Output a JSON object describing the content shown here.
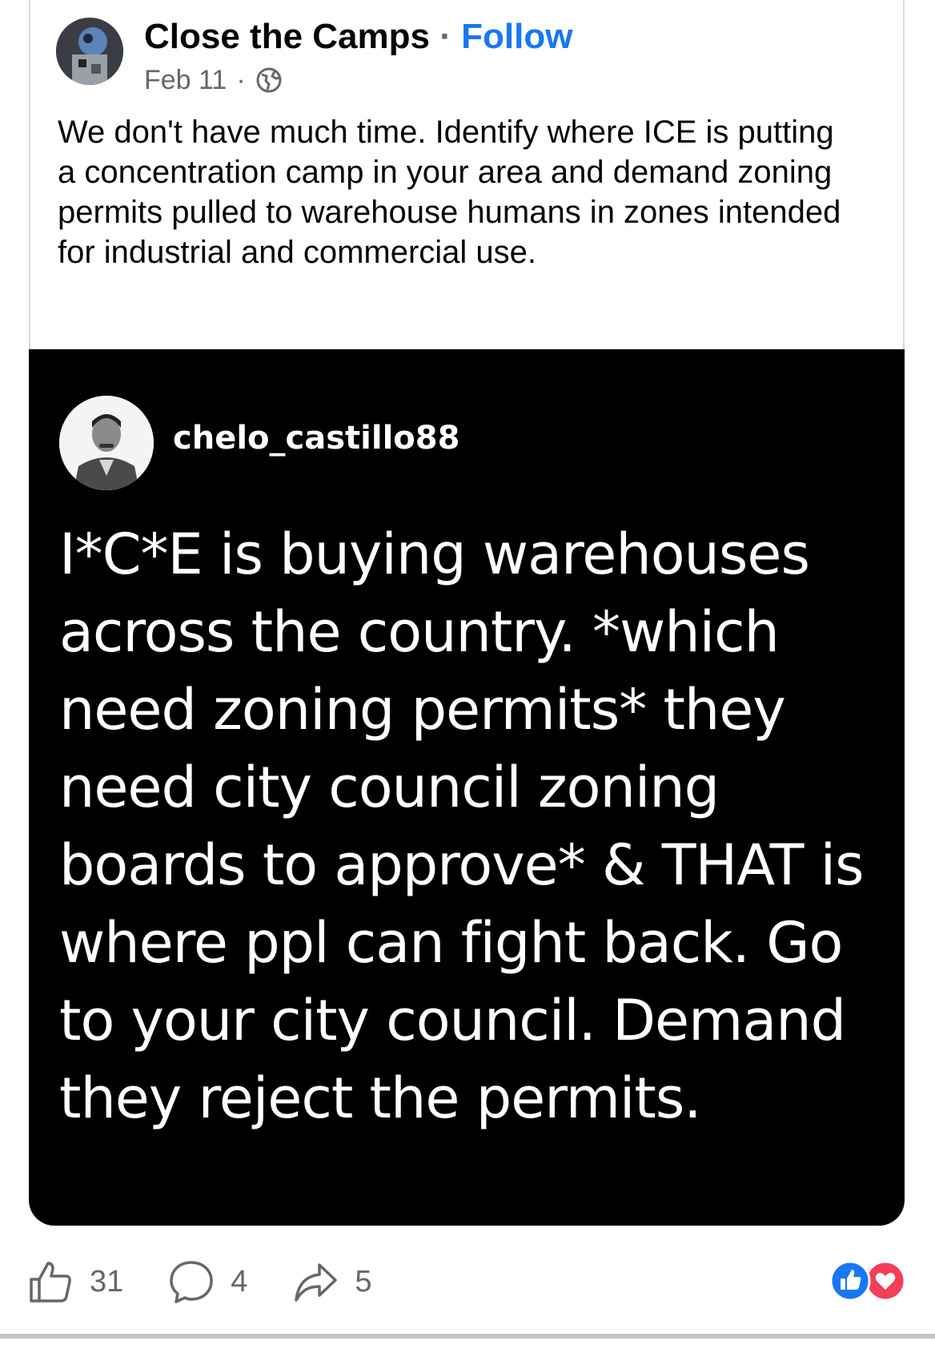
{
  "post": {
    "page_name": "Close the Camps",
    "separator": "·",
    "follow_label": "Follow",
    "date": "Feb 11",
    "date_separator": "·",
    "audience_icon": "globe-icon",
    "caption": "We don't have much time. Identify where ICE is putting a concentration camp in your area and demand zoning permits pulled to warehouse humans in zones intended for industrial and commercial use."
  },
  "shared_image": {
    "handle": "chelo_castillo88",
    "text": "I*C*E is buying warehouses across the country. *which need zoning permits* they need city council zoning boards to approve* & THAT is where ppl can fight back. Go to your city council. Demand they reject the permits."
  },
  "actions": {
    "like_icon": "thumbs-up-icon",
    "like_count": "31",
    "comment_icon": "comment-icon",
    "comment_count": "4",
    "share_icon": "share-icon",
    "share_count": "5",
    "reaction_icons": [
      "like-reaction-icon",
      "love-reaction-icon"
    ]
  },
  "colors": {
    "accent": "#1877f2",
    "love": "#f33e58",
    "muted": "#65676b"
  }
}
